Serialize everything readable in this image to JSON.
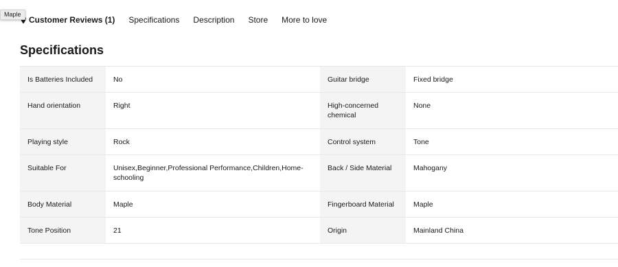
{
  "tooltip": {
    "text": "Maple"
  },
  "tabs": [
    {
      "label": "Customer Reviews (1)",
      "active": true,
      "icon": "location-pin-icon"
    },
    {
      "label": "Specifications",
      "active": false
    },
    {
      "label": "Description",
      "active": false
    },
    {
      "label": "Store",
      "active": false
    },
    {
      "label": "More to love",
      "active": false
    }
  ],
  "section_title": "Specifications",
  "specs": [
    {
      "left_label": "Is Batteries Included",
      "left_value": "No",
      "right_label": "Guitar bridge",
      "right_value": "Fixed bridge"
    },
    {
      "left_label": "Hand orientation",
      "left_value": "Right",
      "right_label": "High-concerned chemical",
      "right_value": "None"
    },
    {
      "left_label": "Playing style",
      "left_value": "Rock",
      "right_label": "Control system",
      "right_value": "Tone"
    },
    {
      "left_label": "Suitable For",
      "left_value": "Unisex,Beginner,Professional Performance,Children,Home-schooling",
      "right_label": "Back / Side Material",
      "right_value": "Mahogany"
    },
    {
      "left_label": "Body Material",
      "left_value": "Maple",
      "right_label": "Fingerboard Material",
      "right_value": "Maple"
    },
    {
      "left_label": "Tone Position",
      "left_value": "21",
      "right_label": "Origin",
      "right_value": "Mainland China"
    }
  ]
}
